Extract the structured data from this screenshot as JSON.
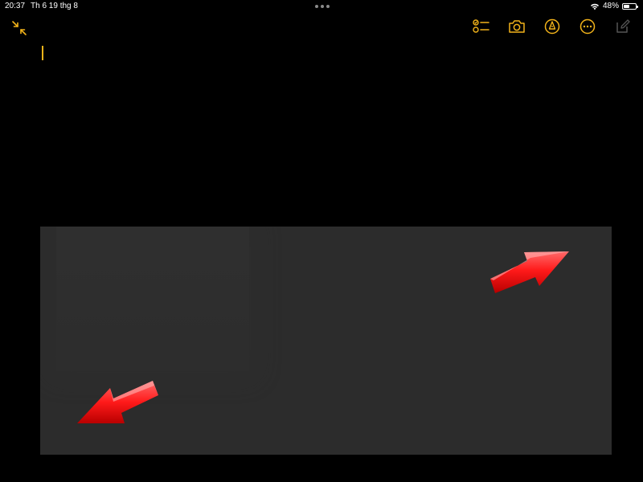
{
  "status_bar": {
    "time": "20:37",
    "date": "Th 6 19 thg 8",
    "battery_percent": "48%",
    "battery_level": 0.48
  },
  "toolbar": {
    "left_icon": "collapse-arrows-icon",
    "right_icons": [
      "checklist-icon",
      "camera-icon",
      "markup-pen-icon",
      "more-ellipsis-icon",
      "compose-icon"
    ]
  },
  "note": {
    "text": ""
  },
  "colors": {
    "accent": "#f2b31a",
    "background": "#000000",
    "image_background": "#2c2c2c",
    "arrow_red": "#e60000"
  }
}
